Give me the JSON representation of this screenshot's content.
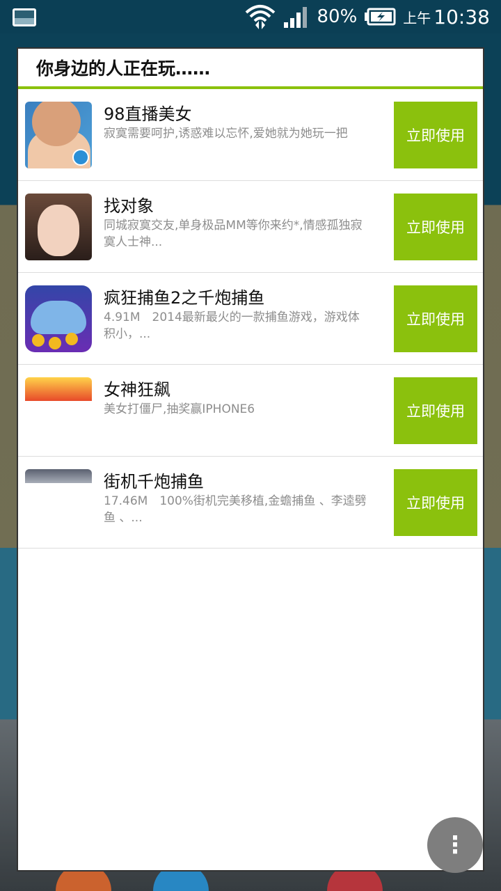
{
  "status_bar": {
    "battery_percent": "80%",
    "ampm": "上午",
    "time": "10:38",
    "icons": [
      "gallery-notification-icon",
      "wifi-icon",
      "signal-icon",
      "battery-charging-icon"
    ]
  },
  "dialog": {
    "title": "你身边的人正在玩……",
    "accent_color": "#8bc10d",
    "apps": [
      {
        "name": "98直播美女",
        "desc": "寂寞需要呵护,诱惑难以忘怀,爱她就为她玩一把",
        "button": "立即使用"
      },
      {
        "name": "找对象",
        "desc": "同城寂寞交友,单身极品MM等你来约*,情感孤独寂寞人士神...",
        "button": "立即使用"
      },
      {
        "name": "疯狂捕鱼2之千炮捕鱼",
        "desc": "4.91M　2014最新最火的一款捕鱼游戏，游戏体积小，...",
        "button": "立即使用"
      },
      {
        "name": "女神狂飙",
        "desc": "美女打僵尸,抽奖赢IPHONE6",
        "button": "立即使用"
      },
      {
        "name": "街机千炮捕鱼",
        "desc": "17.46M　100%街机完美移植,金蟾捕鱼 、李逵劈鱼 、...",
        "button": "立即使用"
      }
    ]
  },
  "fab": {
    "glyph": "⋮"
  }
}
